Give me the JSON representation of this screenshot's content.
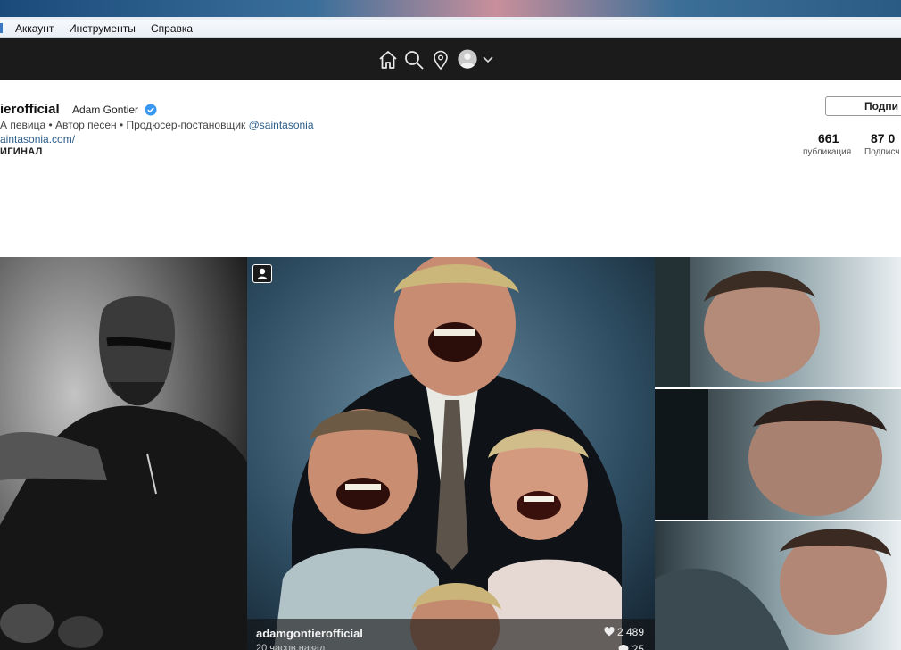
{
  "menu": {
    "items": [
      "Аккаунт",
      "Инструменты",
      "Справка"
    ]
  },
  "nav": {
    "icons": [
      "home-icon",
      "search-icon",
      "location-pin-icon",
      "avatar",
      "chevron-down-icon"
    ]
  },
  "profile": {
    "username": "ierofficial",
    "full_name": "Adam Gontier",
    "bio": "А певица • Автор песен • Продюсер-постановщик",
    "bio_mention": "@saintasonia",
    "website": "aintasonia.com/",
    "original_tag": "ИГИНАЛ",
    "follow_label": "Подпи",
    "stats": [
      {
        "value": "661",
        "label": "публикация"
      },
      {
        "value": "87 0",
        "label": "Подписч"
      }
    ]
  },
  "post_overlay": {
    "username": "adamgontierofficial",
    "time": "20 часов назад",
    "likes": "2 489",
    "comments": "25"
  },
  "colors": {
    "nav_bg": "#1b1b1b",
    "link": "#2d5d8a",
    "verified": "#3897f0"
  }
}
